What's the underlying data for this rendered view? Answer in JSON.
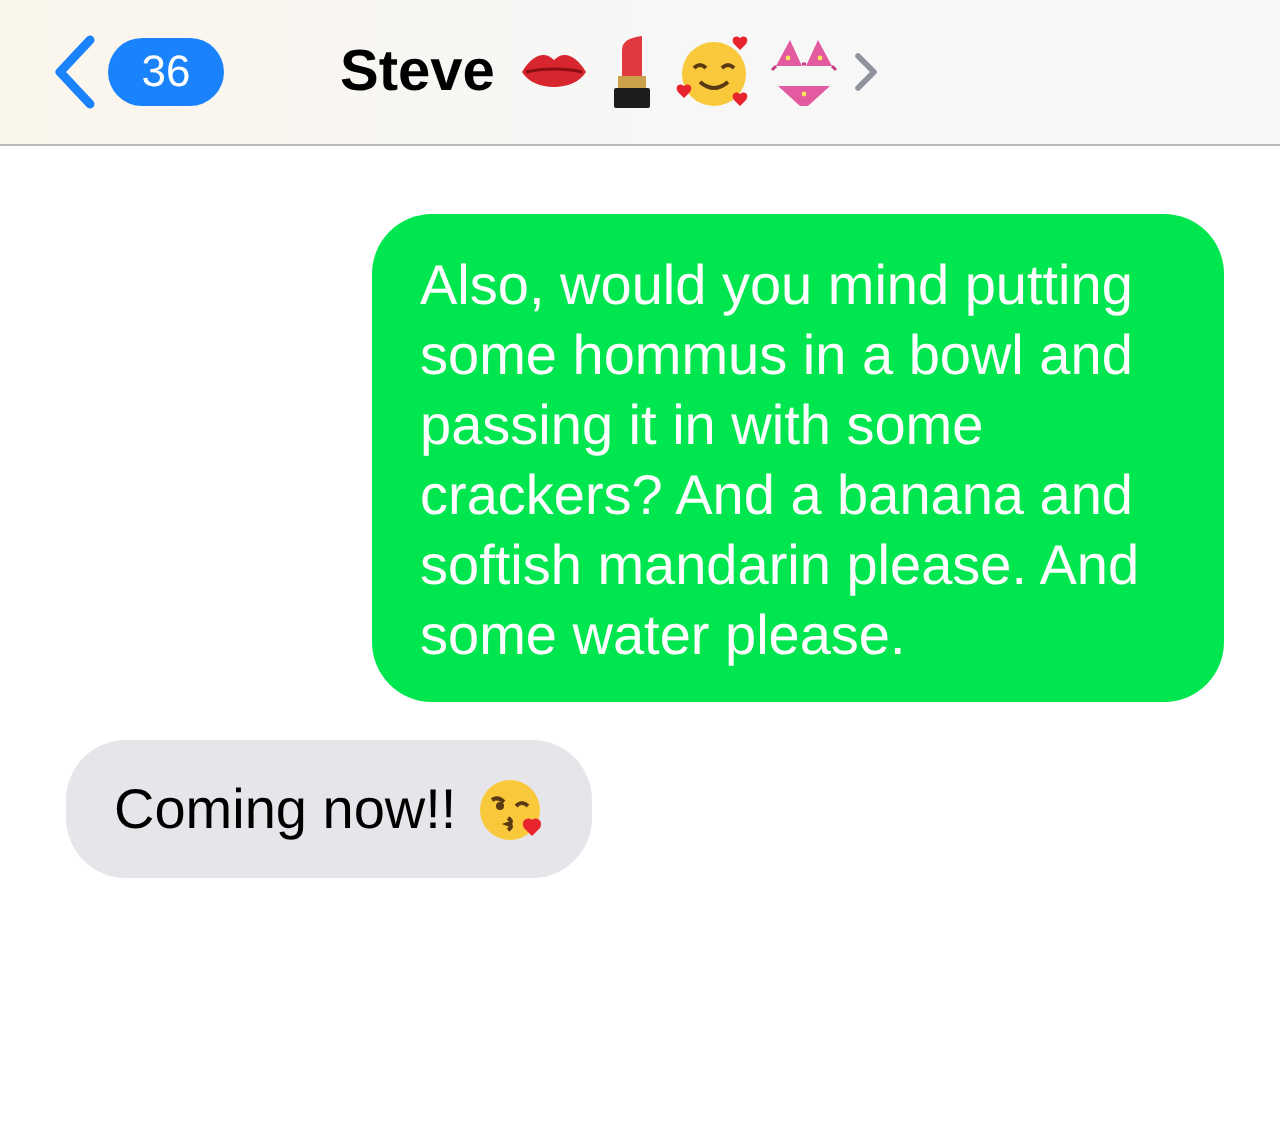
{
  "header": {
    "back_count": "36",
    "contact_name": "Steve"
  },
  "messages": [
    {
      "kind": "sent",
      "text": "Also, would you mind putting some hommus in a bowl and passing it in with some crackers? And a banana and softish mandarin please. And some water please."
    },
    {
      "kind": "received",
      "text": "Coming now!!"
    }
  ]
}
